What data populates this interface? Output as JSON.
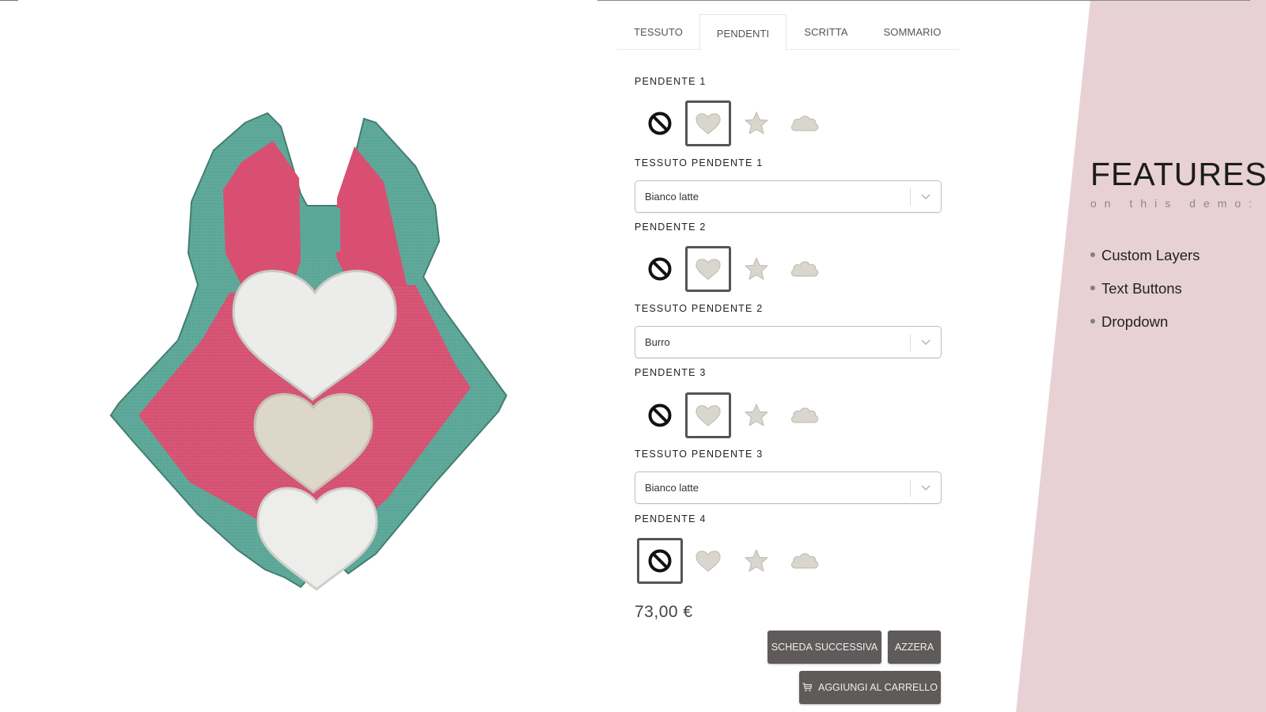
{
  "tabs": [
    {
      "label": "TESSUTO",
      "active": false
    },
    {
      "label": "PENDENTI",
      "active": true
    },
    {
      "label": "SCRITTA",
      "active": false
    },
    {
      "label": "SOMMARIO",
      "active": false
    }
  ],
  "pendants": [
    {
      "label": "PENDENTE 1",
      "options": [
        "none",
        "heart",
        "star",
        "cloud"
      ],
      "selected": "heart",
      "fabric_label": "TESSUTO PENDENTE 1",
      "fabric_value": "Bianco latte"
    },
    {
      "label": "PENDENTE 2",
      "options": [
        "none",
        "heart",
        "star",
        "cloud"
      ],
      "selected": "heart",
      "fabric_label": "TESSUTO PENDENTE 2",
      "fabric_value": "Burro"
    },
    {
      "label": "PENDENTE 3",
      "options": [
        "none",
        "heart",
        "star",
        "cloud"
      ],
      "selected": "heart",
      "fabric_label": "TESSUTO PENDENTE 3",
      "fabric_value": "Bianco latte"
    },
    {
      "label": "PENDENTE 4",
      "options": [
        "none",
        "heart",
        "star",
        "cloud"
      ],
      "selected": "none"
    }
  ],
  "price": "73,00 €",
  "buttons": {
    "next": "SCHEDA SUCCESSIVA",
    "reset": "AZZERA",
    "add_to_cart": "AGGIUNGI AL CARRELLO"
  },
  "features": {
    "title": "FEATURES",
    "subtitle": "on this demo:",
    "items": [
      "Custom Layers",
      "Text Buttons",
      "Dropdown"
    ]
  },
  "colors": {
    "panel_pink": "#e8d1d5",
    "button_gray": "#5f5b5b",
    "fabric_teal": "#5aa898",
    "fabric_pink": "#d94f72",
    "fabric_white": "#ebebe8",
    "fabric_cream": "#dcd7c9"
  }
}
